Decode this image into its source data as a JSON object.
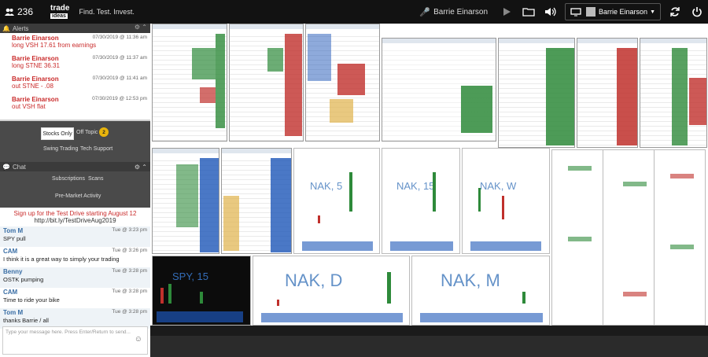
{
  "topbar": {
    "users_count": "236",
    "logo_top": "trade",
    "logo_bottom": "ideas",
    "tagline": "Find. Test. Invest.",
    "host_name": "Barrie Einarson",
    "account_name": "Barrie Einarson"
  },
  "alerts": {
    "title": "Alerts",
    "items": [
      {
        "name": "Barrie Einarson",
        "time": "07/30/2019 @ 11:36 am",
        "msg": "long VSH 17.61 from earnings"
      },
      {
        "name": "Barrie Einarson",
        "time": "07/30/2019 @ 11:37 am",
        "msg": "long STNE 36.31"
      },
      {
        "name": "Barrie Einarson",
        "time": "07/30/2019 @ 11:41 am",
        "msg": "out STNE - .08"
      },
      {
        "name": "Barrie Einarson",
        "time": "07/30/2019 @ 12:53 pm",
        "msg": "out VSH flat"
      }
    ]
  },
  "filters": {
    "stocks_only": "Stocks Only",
    "off_topic": "Off Topic",
    "off_topic_count": "2",
    "swing": "Swing Trading",
    "tech": "Tech Support"
  },
  "chat": {
    "title": "Chat",
    "subscriptions": "Subscriptions",
    "scans": "Scans",
    "premarket": "Pre-Market Activity",
    "promo_line1": "Sign up for the Test Drive starting August 12",
    "promo_line2": "http://bit.ly/TestDriveAug2019",
    "messages": [
      {
        "user": "Tom M",
        "time": "Tue @ 3:23 pm",
        "text": "SPY pull"
      },
      {
        "user": "CAM",
        "time": "Tue @ 3:26 pm",
        "text": "I think it is a great way to simply your trading"
      },
      {
        "user": "Benny",
        "time": "Tue @ 3:28 pm",
        "text": "OSTK pumping"
      },
      {
        "user": "CAM",
        "time": "Tue @ 3:28 pm",
        "text": "Time to ride your bike"
      },
      {
        "user": "Tom M",
        "time": "Tue @ 3:28 pm",
        "text": "thanks Barrie / all"
      }
    ],
    "input_placeholder": "Type your message here. Press Enter/Return to send..."
  },
  "charts": {
    "nak5": "NAK, 5",
    "nak15": "NAK, 15",
    "nakw": "NAK, W",
    "nakd": "NAK, D",
    "nakm": "NAK, M",
    "spy15": "SPY, 15"
  }
}
